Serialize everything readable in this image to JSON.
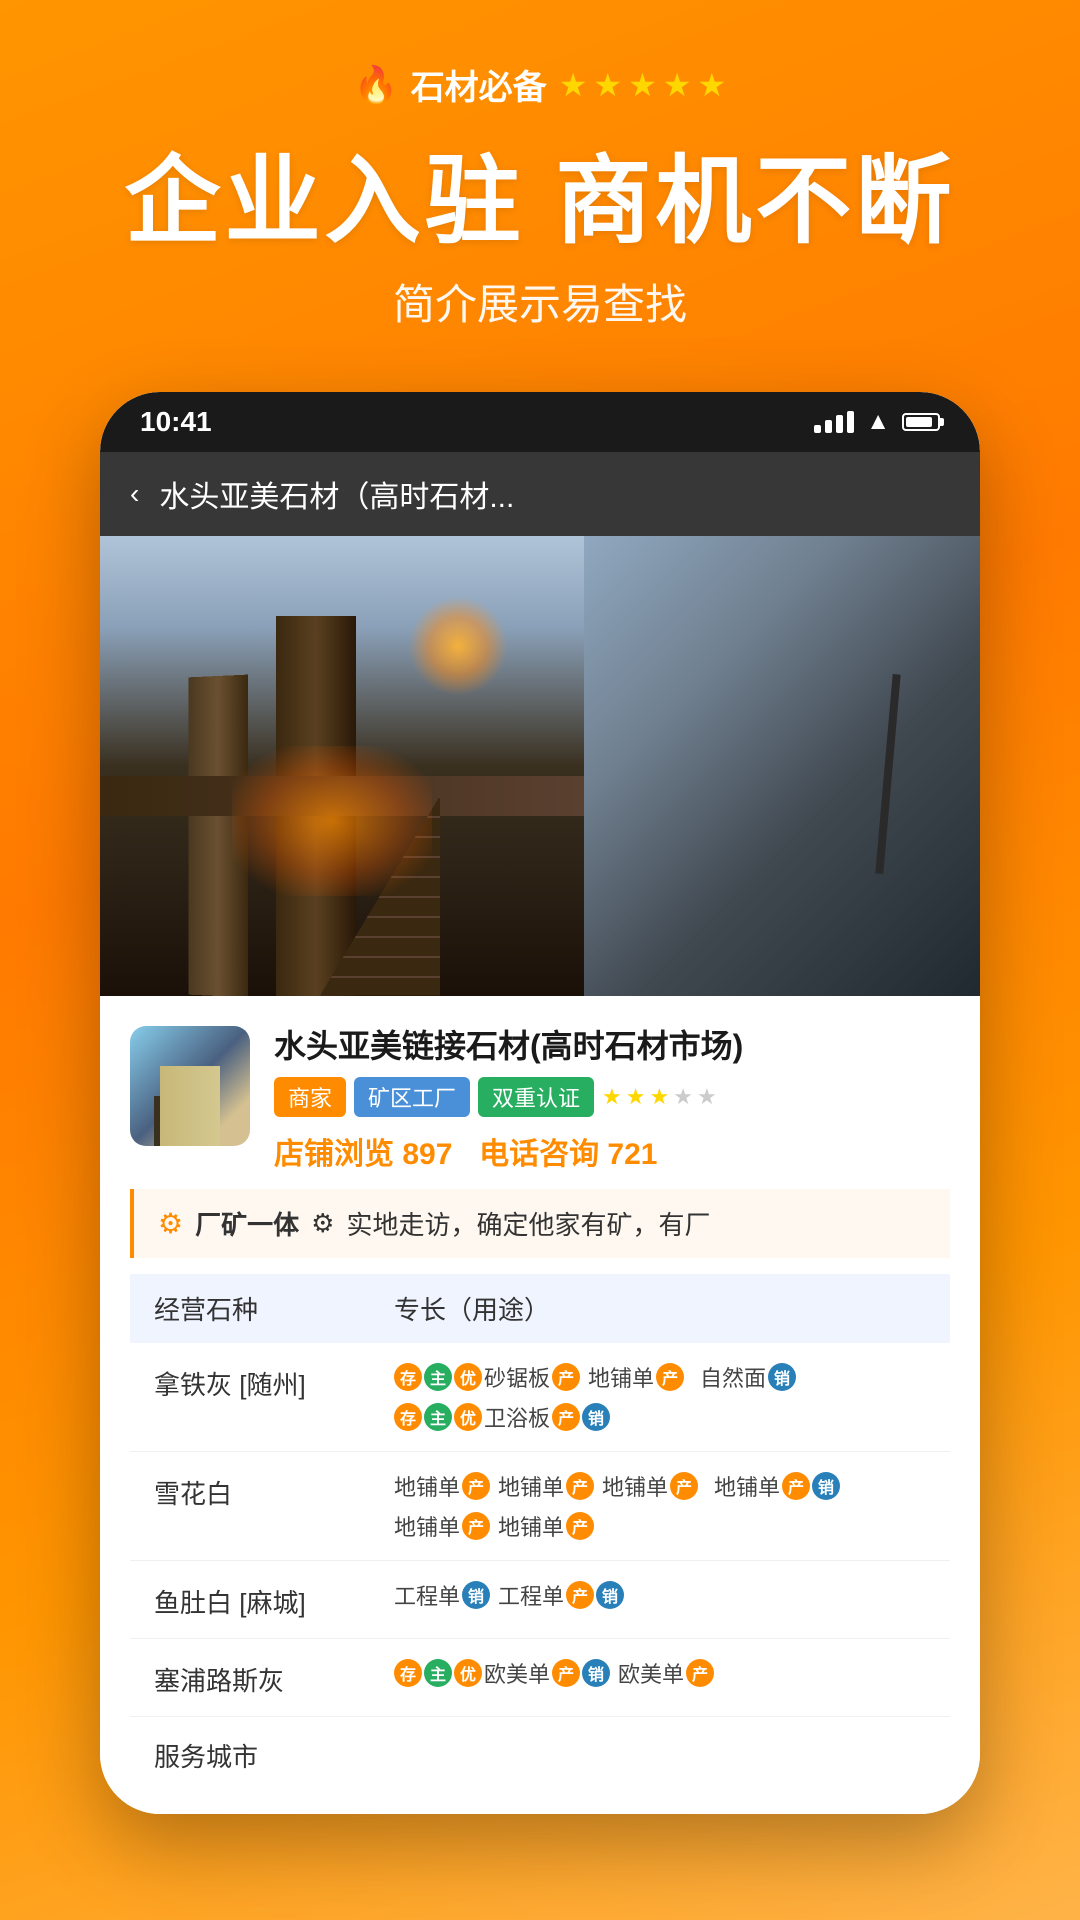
{
  "app": {
    "badge_icon": "🔥",
    "badge_text": "石材必备",
    "stars": [
      "★",
      "★",
      "★",
      "★",
      "★"
    ],
    "hero_title": "企业入驻 商机不断",
    "hero_subtitle": "简介展示易查找"
  },
  "phone": {
    "time": "10:41",
    "nav_back": "‹",
    "nav_title": "水头亚美石材（高时石材..."
  },
  "company": {
    "name": "水头亚美链接石材(高时石材市场)",
    "tags": [
      "商家",
      "矿区工厂",
      "双重认证"
    ],
    "rating_stars": 3.5,
    "views_label": "店铺浏览",
    "views_count": "897",
    "consult_label": "电话咨询",
    "consult_count": "721",
    "factory_badge": "厂矿一体",
    "factory_desc": "实地走访，确定他家有矿，有厂"
  },
  "table": {
    "header": [
      "经营石种",
      "专长（用途）"
    ],
    "rows": [
      {
        "name": "拿铁灰 [随州]",
        "items": [
          "存主优 砂锯板 产",
          "地铺单 产",
          "自然面 销",
          "存主优 卫浴板 产 销"
        ]
      },
      {
        "name": "雪花白",
        "items": [
          "地铺单 产",
          "地铺单 产",
          "地铺单 产",
          "地铺单 产 销",
          "地铺单 产",
          "地铺单 产"
        ]
      },
      {
        "name": "鱼肚白 [麻城]",
        "items": [
          "工程单 销",
          "工程单 产 销"
        ]
      },
      {
        "name": "塞浦路斯灰",
        "items": [
          "存主优 欧美单 产 销",
          "欧美单 产"
        ]
      }
    ],
    "footer_label": "服务城市"
  }
}
